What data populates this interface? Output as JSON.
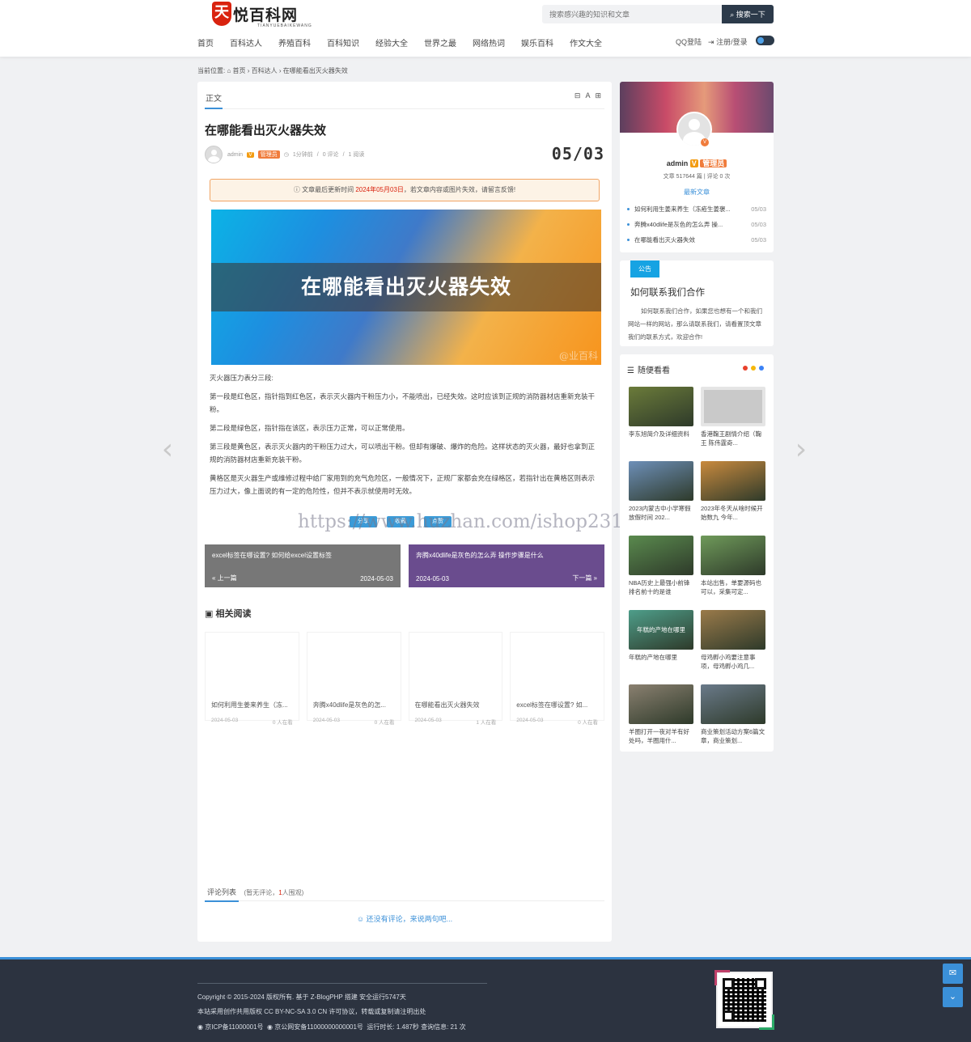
{
  "header": {
    "logo_mark": "天",
    "logo_text": "悦百科网",
    "logo_sub": "TIANYUEBAIKEWANG",
    "search_placeholder": "搜索感兴趣的知识和文章",
    "search_button": "搜索一下",
    "nav": [
      "首页",
      "百科达人",
      "养殖百科",
      "百科知识",
      "经验大全",
      "世界之最",
      "网络热词",
      "娱乐百科",
      "作文大全"
    ],
    "qq_login": "QQ登陆",
    "register_login": "注册/登录"
  },
  "breadcrumb": {
    "prefix": "当前位置:",
    "home": "首页",
    "category": "百科达人",
    "current": "在哪能看出灭火器失效"
  },
  "article": {
    "tab": "正文",
    "tools": "⊟ A ⊞",
    "title": "在哪能看出灭火器失效",
    "author": "admin",
    "v": "V",
    "role": "管理员",
    "time_ago": "1分钟前",
    "comments": "0 评论",
    "views": "1 阅读",
    "date_big": "05/03",
    "notice_prefix": "文章最后更新时间",
    "notice_date": "2024年05月03日",
    "notice_suffix": "，若文章内容或图片失效，请留言反馈!",
    "hero_title": "在哪能看出灭火器失效",
    "hero_watermark": "@业百科",
    "paragraphs": [
      "灭火器压力表分三段:",
      "第一段是红色区，指针指到红色区，表示灭火器内干粉压力小，不能喷出，已经失效。这时应该到正规的消防器材店重新充装干粉。",
      "第二段是绿色区，指针指在该区，表示压力正常，可以正常使用。",
      "第三段是黄色区，表示灭火器内的干粉压力过大，可以喷出干粉。但却有爆破、爆炸的危险。这样状态的灭火器，最好也拿到正规的消防器材店重新充装干粉。",
      "黄格区是灭火器生产或维修过程中给厂家用到的充气危险区，一般情况下，正规厂家都会充在绿格区，若指针出在黄格区则表示压力过大，像上面说的有一定的危险性，但并不表示就使用时无效。"
    ],
    "share": [
      "分享",
      "收藏",
      "点赞"
    ],
    "prev": {
      "title": "excel标签在哪设置? 如何给excel设置标签",
      "label": "« 上一篇",
      "date": "2024-05-03"
    },
    "next": {
      "title": "奔腾x40dlife是灰色的怎么弄 操作步骤是什么",
      "label": "下一篇 »",
      "date": "2024-05-03"
    },
    "related_title": "相关阅读",
    "related": [
      {
        "title": "如何利用生姜来养生（冻...",
        "date": "2024-05-03",
        "views": "0 人在看"
      },
      {
        "title": "奔腾x40dlife是灰色的怎...",
        "date": "2024-05-03",
        "views": "0 人在看"
      },
      {
        "title": "在哪能看出灭火器失效",
        "date": "2024-05-03",
        "views": "1 人在看"
      },
      {
        "title": "excel标签在哪设置? 如...",
        "date": "2024-05-03",
        "views": "0 人在看"
      }
    ],
    "comments_tab": "评论列表",
    "comments_status_prefix": "(暂无评论，",
    "comments_status_count": "1",
    "comments_status_suffix": "人围观)",
    "no_comment": "还没有评论，来说两句吧..."
  },
  "watermark": "https://www.huzhan.com/ishop23165",
  "sidebar": {
    "profile": {
      "name": "admin",
      "v": "V",
      "role": "管理员",
      "stats": "文章 517644 篇 | 评论 0 次",
      "latest_heading": "最新文章",
      "latest": [
        {
          "title": "如何利用生姜来养生（冻疮生姜褒...",
          "date": "05/03"
        },
        {
          "title": "奔腾x40dlife是灰色的怎么弄 操...",
          "date": "05/03"
        },
        {
          "title": "在哪能看出灭火器失效",
          "date": "05/03"
        }
      ]
    },
    "notice": {
      "tag": "公告",
      "title": "如何联系我们合作",
      "body": "如何联系我们合作，如果您也想有一个和我们网站一样的网站，那么请联系我们，请看置顶文章我们的联系方式，欢迎合作!"
    },
    "random": {
      "heading": "随便看看",
      "dot_colors": [
        "#e8412c",
        "#f5b70b",
        "#3b82f6"
      ],
      "items": [
        {
          "caption": "李东旭简介及详细资料",
          "color": "#6b7b3a"
        },
        {
          "caption": "香港鞠王剧情介绍（鞠王 陈伟霆奇...",
          "color": "#9a9a9a"
        },
        {
          "caption": "2023内蒙古中小学寒假放假时间 202...",
          "color": "#6d8fb8"
        },
        {
          "caption": "2023年冬天从啥时候开始数九 今年...",
          "color": "#c98a3e"
        },
        {
          "caption": "NBA历史上最强小前锋排名前十的是谁",
          "color": "#5a8a4e"
        },
        {
          "caption": "本站出售，单要源码也可以，采集可定...",
          "color": "#6f9a5a"
        },
        {
          "caption": "年糕的产地在哪里",
          "color": "#4e9e8a"
        },
        {
          "caption": "母鸡孵小鸡要注意事项，母鸡孵小鸡几...",
          "color": "#9a7a4a"
        },
        {
          "caption": "羊圈打开一夜对羊有好处吗，羊圈用什...",
          "color": "#8a8070"
        },
        {
          "caption": "商业策划活动方案6篇文章，商业策划...",
          "color": "#6a7a8a"
        }
      ],
      "center_text": "年糕的产地在哪里"
    }
  },
  "footer": {
    "line1": "Copyright © 2015-2024 版权所有. 基于 Z-BlogPHP 搭建 安全运行5747天",
    "line2": "本站采用创作共用版权 CC BY-NC-SA 3.0 CN 许可协议，转载或复制请注明出处",
    "icp": "京ICP备11000001号",
    "police": "京公网安备11000000000001号",
    "runtime": "运行时长: 1.487秒 查询信息: 21 次"
  },
  "colors": {
    "accent": "#3b90d8",
    "header_dark": "#2c3a4a",
    "footer_bg": "#2c3340",
    "notice_border": "#f1a565",
    "red": "#d9230f"
  }
}
